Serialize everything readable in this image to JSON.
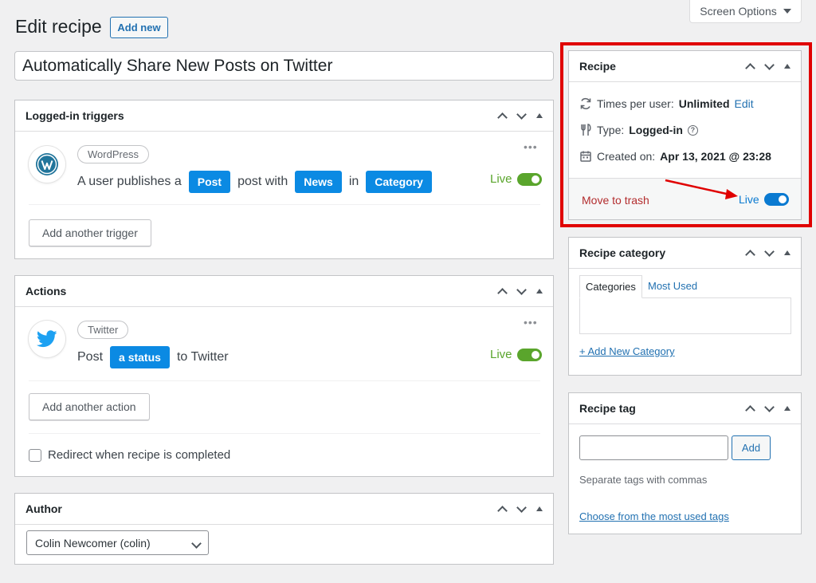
{
  "screen_options": {
    "label": "Screen Options"
  },
  "header": {
    "title": "Edit recipe",
    "add_new_label": "Add new"
  },
  "recipe_title": {
    "value": "Automatically Share New Posts on Twitter"
  },
  "triggers": {
    "title": "Logged-in triggers",
    "integration": "WordPress",
    "sentence": {
      "part1": "A user publishes a",
      "token1": "Post",
      "part2": "post with",
      "token2": "News",
      "part3": "in",
      "token3": "Category"
    },
    "status": "Live",
    "add_label": "Add another trigger"
  },
  "actions": {
    "title": "Actions",
    "integration": "Twitter",
    "sentence": {
      "part1": "Post",
      "token1": "a status",
      "part2": "to Twitter"
    },
    "status": "Live",
    "add_label": "Add another action",
    "redirect_label": "Redirect when recipe is completed"
  },
  "author": {
    "title": "Author",
    "selected": "Colin Newcomer (colin)"
  },
  "recipe_box": {
    "title": "Recipe",
    "times_label": "Times per user:",
    "times_value": "Unlimited",
    "times_edit": "Edit",
    "type_label": "Type:",
    "type_value": "Logged-in",
    "created_label": "Created on:",
    "created_value": "Apr 13, 2021 @ 23:28",
    "trash_label": "Move to trash",
    "status": "Live"
  },
  "category_box": {
    "title": "Recipe category",
    "tabs": [
      "Categories",
      "Most Used"
    ],
    "add_link": "+ Add New Category"
  },
  "tag_box": {
    "title": "Recipe tag",
    "add_label": "Add",
    "hint": "Separate tags with commas",
    "choose_link": "Choose from the most used tags"
  },
  "colors": {
    "highlight": "#e00000",
    "live_green": "#5aa52c",
    "token_blue": "#0b8ae3",
    "wp_blue": "#2271b1"
  }
}
